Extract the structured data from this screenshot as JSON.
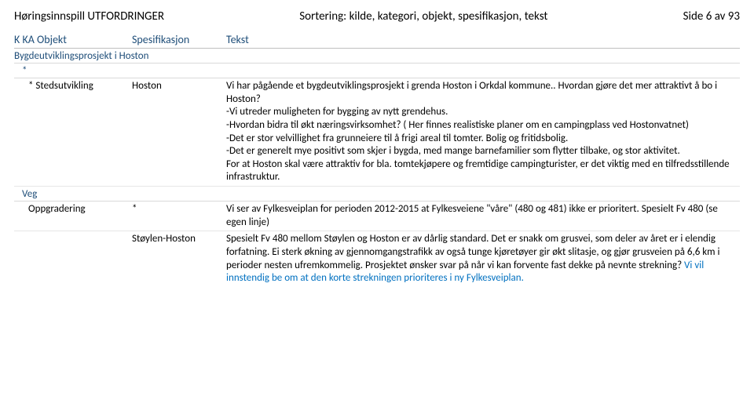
{
  "header": {
    "left": "Høringsinnspill UTFORDRINGER",
    "center": "Sortering: kilde, kategori, objekt, spesifikasjon, tekst",
    "right": "Side 6 av 93"
  },
  "colheads": {
    "c1": "K   KA  Objekt",
    "c2": "Spesifikasjon",
    "c3": "Tekst"
  },
  "section1": "Bygdeutviklingsprosjekt i Hoston",
  "star": "*",
  "entry1": {
    "obj": "*   Stedsutvikling",
    "spec": "Hoston",
    "text": "Vi har pågående et bygdeutviklingsprosjekt i grenda Hoston i Orkdal kommune.. Hvordan gjøre det mer attraktivt å bo i Hoston?\n-Vi utreder muligheten for bygging av nytt grendehus.\n-Hvordan bidra til økt næringsvirksomhet? ( Her finnes realistiske planer om en campingplass ved Hostonvatnet)\n-Det er stor velvillighet fra grunneiere til å frigi areal til tomter. Bolig og fritidsbolig.\n-Det er generelt mye positivt som skjer i bygda, med mange barnefamilier som flytter tilbake, og stor aktivitet.\nFor at Hoston skal være attraktiv for bla. tomtekjøpere og fremtidige campingturister, er det viktig med en tilfredsstillende infrastruktur."
  },
  "section2": "Veg",
  "entry2": {
    "obj": "Oppgradering",
    "spec": "*",
    "text": "Vi ser av Fylkesveiplan for perioden 2012-2015 at Fylkesveiene \"våre\" (480 og 481) ikke er prioritert.  Spesielt Fv 480 (se egen linje)"
  },
  "entry3": {
    "obj": "",
    "spec": "Støylen-Hoston",
    "textA": "Spesielt Fv 480 mellom Støylen og Hoston er av dårlig standard. Det er snakk om grusvei, som deler av året er i elendig forfatning. Ei sterk økning av gjennomgangstrafikk av  også tunge kjøretøyer gir økt slitasje, og gjør grusveien på 6,6 km i perioder nesten  ufremkommelig.  Prosjektet ønsker svar på når vi kan forvente fast dekke på nevnte strekning? ",
    "textB": " Vi vil innstendig be om at den korte strekningen prioriteres i ny Fylkesveiplan."
  }
}
